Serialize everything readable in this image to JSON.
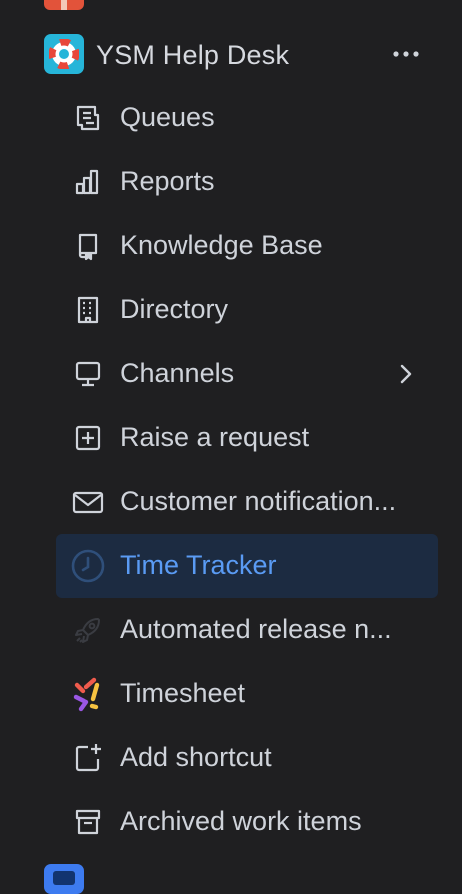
{
  "project": {
    "name": "YSM Help Desk",
    "logo_icon": "lifebuoy-icon",
    "more_icon": "more-horizontal-icon"
  },
  "nav": [
    {
      "label": "Queues",
      "icon": "queues-icon"
    },
    {
      "label": "Reports",
      "icon": "reports-icon"
    },
    {
      "label": "Knowledge Base",
      "icon": "knowledge-base-icon"
    },
    {
      "label": "Directory",
      "icon": "building-icon"
    },
    {
      "label": "Channels",
      "icon": "monitor-icon",
      "has_children": true
    },
    {
      "label": "Raise a request",
      "icon": "plus-square-icon"
    },
    {
      "label": "Customer notification...",
      "icon": "email-icon"
    },
    {
      "label": "Time Tracker",
      "icon": "clock-icon",
      "selected": true
    },
    {
      "label": "Automated release n...",
      "icon": "rocket-icon"
    },
    {
      "label": "Timesheet",
      "icon": "timesheet-app-icon"
    },
    {
      "label": "Add shortcut",
      "icon": "add-shortcut-icon"
    },
    {
      "label": "Archived work items",
      "icon": "archive-icon"
    }
  ],
  "colors": {
    "background": "#1f1f21",
    "text": "#cfd3da",
    "selected_bg": "#1c2b41",
    "selected_text": "#5a9bf4",
    "logo_bg": "#26b5d9"
  }
}
